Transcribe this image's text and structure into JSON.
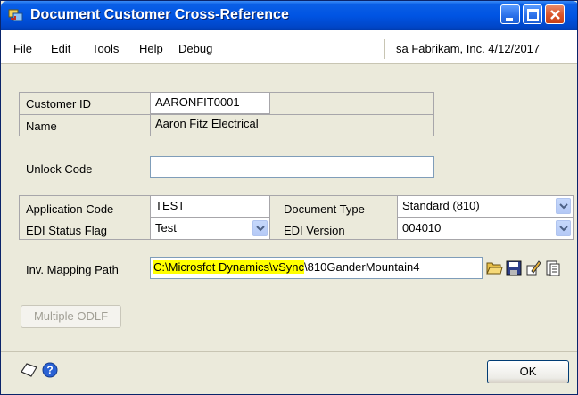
{
  "window": {
    "title": "Document Customer Cross-Reference"
  },
  "menu": {
    "file": "File",
    "edit": "Edit",
    "tools": "Tools",
    "help": "Help",
    "debug": "Debug"
  },
  "company_info": "sa  Fabrikam, Inc.  4/12/2017",
  "labels": {
    "customer_id": "Customer ID",
    "name": "Name",
    "unlock_code": "Unlock Code",
    "application_code": "Application Code",
    "document_type": "Document Type",
    "edi_status_flag": "EDI Status Flag",
    "edi_version": "EDI Version",
    "inv_mapping_path": "Inv. Mapping Path"
  },
  "values": {
    "customer_id": "AARONFIT0001",
    "name": "Aaron Fitz Electrical",
    "unlock_code": "",
    "application_code": "TEST",
    "document_type": "Standard (810)",
    "edi_status_flag": "Test",
    "edi_version": "004010",
    "path_highlighted": "C:\\Microsfot Dynamics\\vSync",
    "path_rest": "\\810GanderMountain4"
  },
  "buttons": {
    "multiple_odlf": "Multiple ODLF",
    "ok": "OK"
  },
  "icons": {
    "window": "window-icon",
    "minimize": "minimize-icon",
    "maximize": "maximize-icon",
    "close": "close-icon",
    "folder": "folder-open-icon",
    "save": "save-icon",
    "edit": "edit-icon",
    "paste": "paste-icon",
    "note": "note-icon",
    "help": "help-icon"
  }
}
